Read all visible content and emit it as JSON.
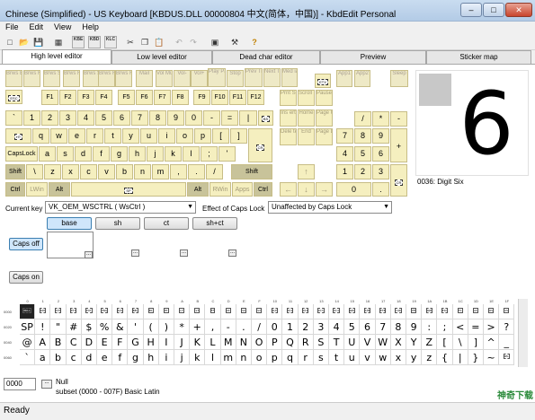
{
  "window": {
    "title": "Chinese (Simplified) - US Keyboard [KBDUS.DLL 00000804 中文(简体，中国)] - KbdEdit Personal",
    "btn_min": "–",
    "btn_max": "□",
    "btn_close": "✕"
  },
  "menu": [
    "File",
    "Edit",
    "View",
    "Help"
  ],
  "toolbar": {
    "kbe": "KBE",
    "kbd": "KBD",
    "klc": "KLC",
    "cut": "✂",
    "copy": "❐",
    "paste": "📋",
    "undo": "↶",
    "redo": "↷",
    "tools": "⚒",
    "help": "?"
  },
  "tabs": [
    "High level editor",
    "Low level editor",
    "Dead char editor",
    "Preview",
    "Sticker map"
  ],
  "keys": {
    "fn_row": [
      "Brws Back",
      "Brws Fwd",
      "Brws Stop",
      "Brws Rfrsh",
      "Brws Srch",
      "Brws Fvrt",
      "Brws Home",
      "Mail",
      "Vol Mute",
      "Vol-",
      "Vol+",
      "Play Pause",
      "Stop",
      "Prev Trck",
      "Next Trck",
      "Med ia",
      "App1",
      "App2",
      "Sleep"
    ],
    "esc": "ESC",
    "etx": "ETX",
    "f_row": [
      "F1",
      "F2",
      "F3",
      "F4",
      "F5",
      "F6",
      "F7",
      "F8",
      "F9",
      "F10",
      "F11",
      "F12"
    ],
    "prt": "Prnt Scrn",
    "scrl": "Scroll Lock",
    "brk": "Pause Break",
    "num_row": [
      "`",
      "1",
      "2",
      "3",
      "4",
      "5",
      "6",
      "7",
      "8",
      "9",
      "0",
      "-",
      "="
    ],
    "bs": "BS",
    "ins": "Ins ert",
    "home": "Home",
    "pgup": "Page Up",
    "slash": "/",
    "star": "*",
    "minus": "-",
    "ht": "HT",
    "q_row": [
      "q",
      "w",
      "e",
      "r",
      "t",
      "y",
      "u",
      "i",
      "o",
      "p",
      "[",
      "]"
    ],
    "del": "Dele te",
    "end": "End",
    "pgdn": "Page Down",
    "n7": "7",
    "n8": "8",
    "n9": "9",
    "plus": "+",
    "caps": "CapsLock",
    "a_row": [
      "a",
      "s",
      "d",
      "f",
      "g",
      "h",
      "j",
      "k",
      "l",
      ";",
      "'"
    ],
    "cr": "CR",
    "n4": "4",
    "n5": "5",
    "n6": "6",
    "shift_l": "Shift",
    "z_row": [
      "\\",
      "z",
      "x",
      "c",
      "v",
      "b",
      "n",
      "m",
      ",",
      ".",
      "/"
    ],
    "shift_r": "Shift",
    "up": "↑",
    "n1": "1",
    "n2": "2",
    "n3": "3",
    "ctrl_l": "Ctrl",
    "lwin": "LWin",
    "alt_l": "Alt",
    "sp": "SP",
    "alt_r": "Alt",
    "rwin": "RWin",
    "apps": "Apps",
    "ctrl_r": "Ctrl",
    "left": "←",
    "down": "↓",
    "right": "→",
    "n0": "0",
    "dot": ".",
    "bar": "|"
  },
  "preview": {
    "glyph": "6",
    "caption": "0036: Digit Six"
  },
  "controls": {
    "current_key_label": "Current key",
    "current_key_value": "VK_OEM_WSCTRL ( WsCtrl )",
    "caps_label": "Effect of Caps Lock",
    "caps_value": "Unaffected by Caps Lock",
    "states": [
      "base",
      "sh",
      "ct",
      "sh+ct"
    ],
    "caps_off": "Caps off",
    "caps_on": "Caps on",
    "ellipsis": "..."
  },
  "grid": {
    "cols": [
      "0",
      "1",
      "2",
      "3",
      "4",
      "5",
      "6",
      "7",
      "8",
      "9",
      "A",
      "B",
      "C",
      "D",
      "E",
      "F",
      "10",
      "11",
      "12",
      "13",
      "14",
      "15",
      "16",
      "17",
      "18",
      "19",
      "1A",
      "1B",
      "1C",
      "1D",
      "1E",
      "1F"
    ],
    "rows": [
      "0000",
      "0020",
      "0040",
      "0060"
    ],
    "row0": [
      "NULL",
      "SOH",
      "STX",
      "ETX",
      "EOT",
      "ENQ",
      "ACK",
      "BEL",
      "BS",
      "HT",
      "LF",
      "VT",
      "FF",
      "CR",
      "SO",
      "SI",
      "DLE",
      "DC1",
      "DC2",
      "DC3",
      "DC4",
      "NAK",
      "SYN",
      "ETB",
      "CAN",
      "EM",
      "SUB",
      "ESC",
      "FS",
      "GS",
      "RS",
      "US"
    ],
    "row1": [
      "SP",
      "!",
      "\"",
      "#",
      "$",
      "%",
      "&",
      "'",
      "(",
      ")",
      "*",
      "+",
      ",",
      "-",
      ".",
      "/",
      "0",
      "1",
      "2",
      "3",
      "4",
      "5",
      "6",
      "7",
      "8",
      "9",
      ":",
      ";",
      "<",
      "=",
      ">",
      "?"
    ],
    "row2": [
      "@",
      "A",
      "B",
      "C",
      "D",
      "E",
      "F",
      "G",
      "H",
      "I",
      "J",
      "K",
      "L",
      "M",
      "N",
      "O",
      "P",
      "Q",
      "R",
      "S",
      "T",
      "U",
      "V",
      "W",
      "X",
      "Y",
      "Z",
      "[",
      "\\",
      "]",
      "^",
      "_"
    ],
    "row3": [
      "`",
      "a",
      "b",
      "c",
      "d",
      "e",
      "f",
      "g",
      "h",
      "i",
      "j",
      "k",
      "l",
      "m",
      "n",
      "o",
      "p",
      "q",
      "r",
      "s",
      "t",
      "u",
      "v",
      "w",
      "x",
      "y",
      "z",
      "{",
      "|",
      "}",
      "~",
      "DEL"
    ]
  },
  "bottom": {
    "code": "0000",
    "name": "Null",
    "subset": "subset (0000 - 007F) Basic Latin"
  },
  "status": "Ready",
  "watermark": "神奇下载"
}
